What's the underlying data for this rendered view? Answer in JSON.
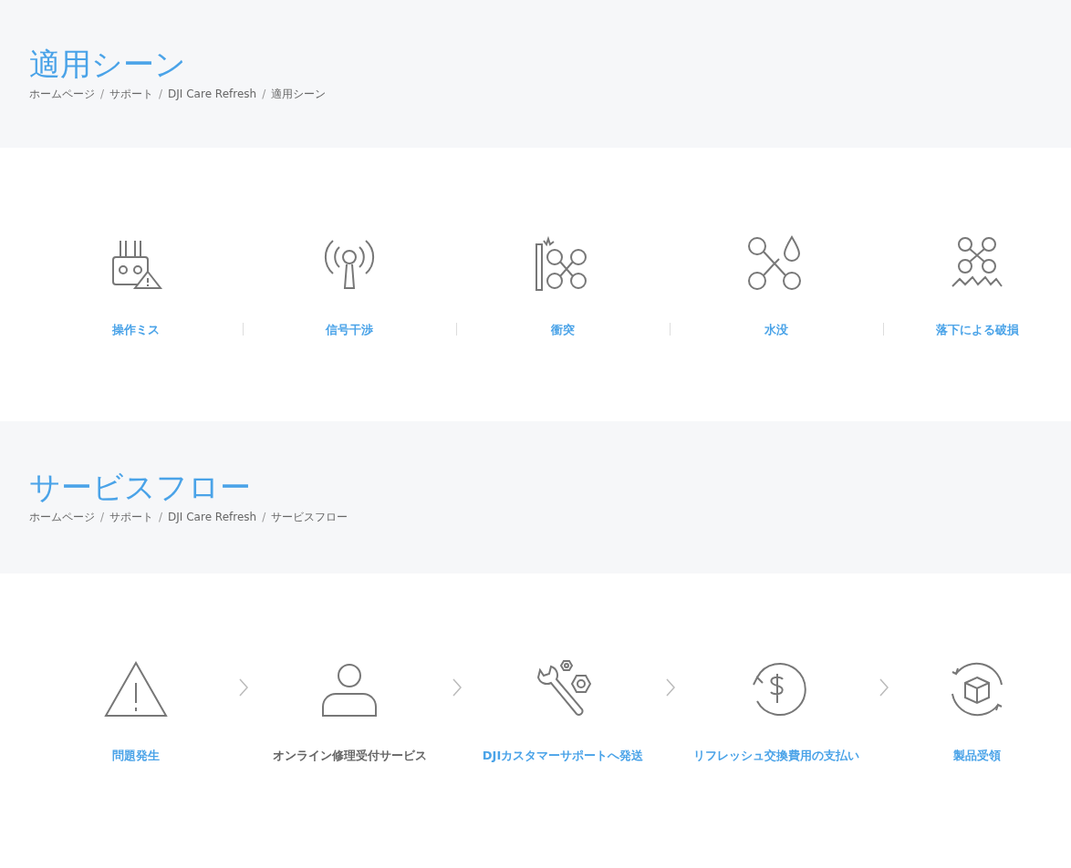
{
  "sections": [
    {
      "title": "適用シーン",
      "breadcrumb": [
        {
          "kind": "link",
          "text": "ホームページ"
        },
        {
          "kind": "separator",
          "text": "/"
        },
        {
          "kind": "link",
          "text": "サポート"
        },
        {
          "kind": "separator",
          "text": "/"
        },
        {
          "kind": "link",
          "text": "DJI Care Refresh"
        },
        {
          "kind": "separator",
          "text": "/"
        },
        {
          "kind": "current",
          "text": "適用シーン"
        }
      ],
      "items": [
        {
          "label": "操作ミス",
          "linked": true
        },
        {
          "label": "信号干渉",
          "linked": true
        },
        {
          "label": "衝突",
          "linked": true
        },
        {
          "label": "水没",
          "linked": true
        },
        {
          "label": "落下による破損",
          "linked": true
        }
      ]
    },
    {
      "title": "サービスフロー",
      "breadcrumb": [
        {
          "kind": "link",
          "text": "ホームページ"
        },
        {
          "kind": "separator",
          "text": "/"
        },
        {
          "kind": "link",
          "text": "サポート"
        },
        {
          "kind": "separator",
          "text": "/"
        },
        {
          "kind": "link",
          "text": "DJI Care Refresh"
        },
        {
          "kind": "separator",
          "text": "/"
        },
        {
          "kind": "current",
          "text": "サービスフロー"
        }
      ],
      "items": [
        {
          "label": "問題発生",
          "linked": true
        },
        {
          "label": "オンライン修理受付サービス",
          "linked": false
        },
        {
          "label": "DJIカスタマーサポートへ発送",
          "linked": true
        },
        {
          "label": "リフレッシュ交換費用の支払い",
          "linked": true
        },
        {
          "label": "製品受領",
          "linked": true
        }
      ]
    }
  ]
}
